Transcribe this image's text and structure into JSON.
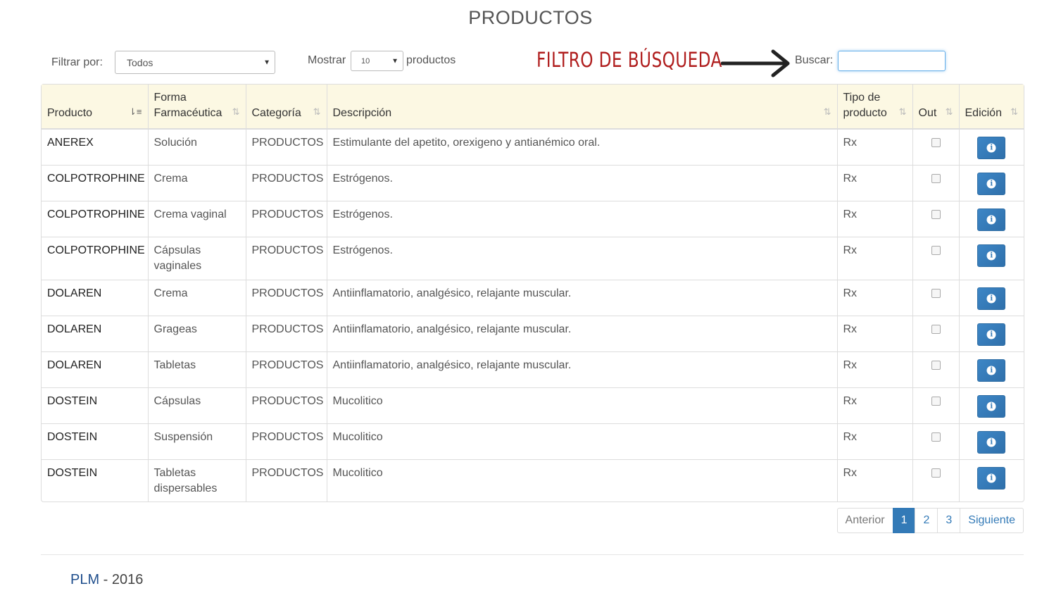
{
  "page": {
    "title": "PRODUCTOS"
  },
  "filters": {
    "filter_label": "Filtrar por:",
    "filter_value": "Todos",
    "show_label": "Mostrar",
    "show_value": "10",
    "show_suffix": "productos",
    "search_label": "Buscar:",
    "search_value": ""
  },
  "annotation": {
    "text": "FILTRO DE BÚSQUEDA"
  },
  "table": {
    "headers": {
      "producto": "Producto",
      "forma_1": "Forma",
      "forma_2": "Farmacéutica",
      "categoria": "Categoría",
      "descripcion": "Descripción",
      "tipo_1": "Tipo de",
      "tipo_2": "producto",
      "out": "Out",
      "edicion": "Edición"
    },
    "rows": [
      {
        "producto": "ANEREX",
        "forma": "Solución",
        "categoria": "PRODUCTOS",
        "descripcion": "Estimulante del apetito, orexigeno y antianémico oral.",
        "tipo": "Rx"
      },
      {
        "producto": "COLPOTROPHINE",
        "forma": "Crema",
        "categoria": "PRODUCTOS",
        "descripcion": "Estrógenos.",
        "tipo": "Rx"
      },
      {
        "producto": "COLPOTROPHINE",
        "forma": "Crema vaginal",
        "categoria": "PRODUCTOS",
        "descripcion": "Estrógenos.",
        "tipo": "Rx"
      },
      {
        "producto": "COLPOTROPHINE",
        "forma": "Cápsulas vaginales",
        "categoria": "PRODUCTOS",
        "descripcion": "Estrógenos.",
        "tipo": "Rx"
      },
      {
        "producto": "DOLAREN",
        "forma": "Crema",
        "categoria": "PRODUCTOS",
        "descripcion": "Antiinflamatorio, analgésico, relajante muscular.",
        "tipo": "Rx"
      },
      {
        "producto": "DOLAREN",
        "forma": "Grageas",
        "categoria": "PRODUCTOS",
        "descripcion": "Antiinflamatorio, analgésico, relajante muscular.",
        "tipo": "Rx"
      },
      {
        "producto": "DOLAREN",
        "forma": "Tabletas",
        "categoria": "PRODUCTOS",
        "descripcion": "Antiinflamatorio, analgésico, relajante muscular.",
        "tipo": "Rx"
      },
      {
        "producto": "DOSTEIN",
        "forma": "Cápsulas",
        "categoria": "PRODUCTOS",
        "descripcion": "Mucolitico",
        "tipo": "Rx"
      },
      {
        "producto": "DOSTEIN",
        "forma": "Suspensión",
        "categoria": "PRODUCTOS",
        "descripcion": "Mucolitico",
        "tipo": "Rx"
      },
      {
        "producto": "DOSTEIN",
        "forma": "Tabletas dispersables",
        "categoria": "PRODUCTOS",
        "descripcion": "Mucolitico",
        "tipo": "Rx"
      }
    ]
  },
  "pagination": {
    "prev": "Anterior",
    "pages": [
      "1",
      "2",
      "3"
    ],
    "active_page": "1",
    "next": "Siguiente"
  },
  "footer": {
    "brand": "PLM",
    "separator": " - ",
    "year": "2016"
  },
  "colors": {
    "accent": "#337ab7",
    "header_bg": "#fcf8e3",
    "annotation": "#b01e1e"
  },
  "icons": {
    "row_action": "info-icon",
    "sort": "sort-icon"
  }
}
